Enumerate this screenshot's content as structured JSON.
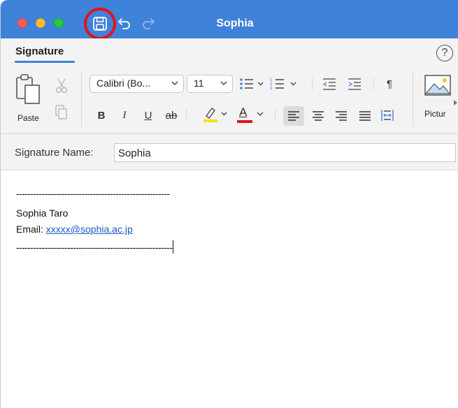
{
  "window": {
    "title": "Sophia",
    "accent": "#3f82d9",
    "highlight_color": "#e0141b"
  },
  "titlebar": {
    "icons": [
      "save-icon",
      "undo-icon",
      "redo-icon"
    ]
  },
  "ribbon": {
    "active_tab": "Signature",
    "paste_label": "Paste",
    "font_name": "Calibri (Bo...",
    "font_size": "11",
    "bold": "B",
    "italic": "I",
    "underline": "U",
    "strikethrough": "ab",
    "font_color_letter": "A",
    "pilcrow": "¶",
    "pictures_label": "Pictur",
    "help": "?"
  },
  "signature_name": {
    "label": "Signature Name:",
    "value": "Sophia"
  },
  "editor": {
    "line1": "------------------------------------------------------",
    "line2": "Sophia Taro",
    "email_prefix": "Email: ",
    "email": "xxxxx@sophia.ac.jp",
    "line4": "-------------------------------------------------------"
  }
}
